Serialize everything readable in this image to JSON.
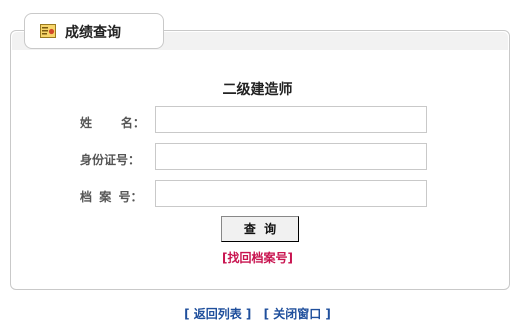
{
  "tab": {
    "title": "成绩查询",
    "icon": "certificate-icon"
  },
  "form": {
    "title": "二级建造师",
    "fields": [
      {
        "label": "姓    名：",
        "value": ""
      },
      {
        "label": "身份证号：",
        "value": ""
      },
      {
        "label": "档 案 号：",
        "value": ""
      }
    ],
    "query_button": "查  询",
    "recover_link": "[找回档案号]"
  },
  "footer": {
    "back_link": "[ 返回列表 ]",
    "close_link": "[ 关闭窗口 ]"
  },
  "colors": {
    "link_blue": "#1f4f9c",
    "link_red": "#c8134f",
    "border": "#c9c9c9"
  }
}
